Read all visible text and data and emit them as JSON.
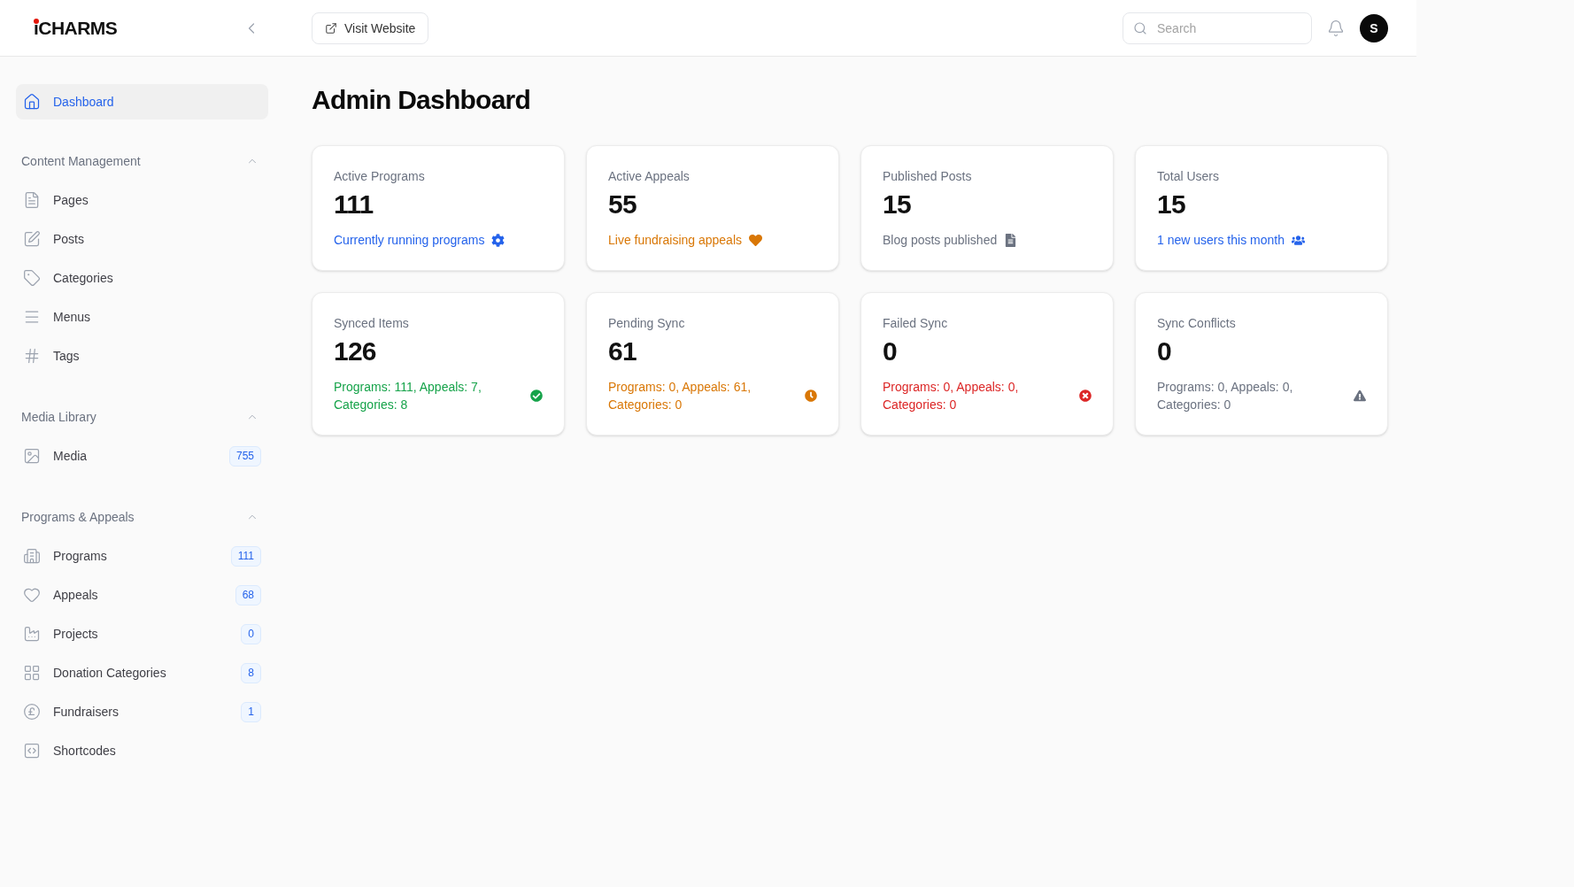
{
  "header": {
    "logo": {
      "mark": "i",
      "name": "CHARMS"
    },
    "visit_button": "Visit Website",
    "search": {
      "placeholder": "Search"
    },
    "avatar": "S"
  },
  "sidebar": {
    "dashboard": {
      "label": "Dashboard",
      "selected": true
    },
    "sections": [
      {
        "title": "Content Management",
        "expanded": true,
        "items": [
          {
            "label": "Pages",
            "selected": false
          },
          {
            "label": "Posts",
            "selected": false
          },
          {
            "label": "Categories",
            "selected": false
          },
          {
            "label": "Menus",
            "selected": false
          },
          {
            "label": "Tags",
            "selected": false
          }
        ]
      },
      {
        "title": "Media Library",
        "expanded": true,
        "items": [
          {
            "label": "Media",
            "badge": "755",
            "selected": false
          }
        ]
      },
      {
        "title": "Programs & Appeals",
        "expanded": true,
        "items": [
          {
            "label": "Programs",
            "badge": "111",
            "selected": false
          },
          {
            "label": "Appeals",
            "badge": "68",
            "selected": false
          },
          {
            "label": "Projects",
            "badge": "0",
            "selected": false
          },
          {
            "label": "Donation Categories",
            "badge": "8",
            "selected": false
          },
          {
            "label": "Fundraisers",
            "badge": "1",
            "selected": false
          },
          {
            "label": "Shortcodes",
            "selected": false
          }
        ]
      }
    ]
  },
  "page_title": "Admin Dashboard",
  "stat_cards": [
    {
      "title": "Active Programs",
      "value": "111",
      "description": "Currently running programs",
      "color": "#2563eb"
    },
    {
      "title": "Active Appeals",
      "value": "55",
      "description": "Live fundraising appeals",
      "color": "#d97706"
    },
    {
      "title": "Published Posts",
      "value": "15",
      "description": "Blog posts published",
      "color": "#6b7280"
    },
    {
      "title": "Total Users",
      "value": "15",
      "description": "1 new users this month",
      "color": "#2563eb"
    }
  ],
  "sync_cards": [
    {
      "title": "Synced Items",
      "value": "126",
      "description": "Programs: 111, Appeals: 7, Categories: 8",
      "color": "#16a34a"
    },
    {
      "title": "Pending Sync",
      "value": "61",
      "description": "Programs: 0, Appeals: 61, Categories: 0",
      "color": "#d97706"
    },
    {
      "title": "Failed Sync",
      "value": "0",
      "description": "Programs: 0, Appeals: 0, Categories: 0",
      "color": "#dc2626"
    },
    {
      "title": "Sync Conflicts",
      "value": "0",
      "description": "Programs: 0, Appeals: 0, Categories: 0",
      "color": "#6b7280"
    }
  ]
}
